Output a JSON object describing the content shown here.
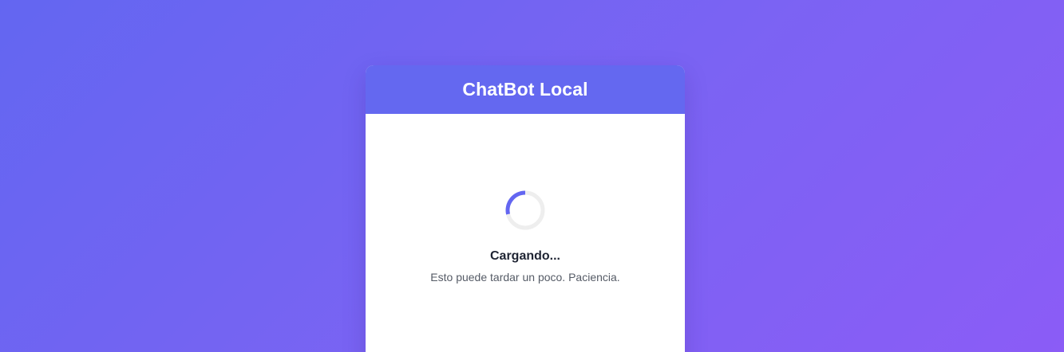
{
  "app": {
    "title": "ChatBot Local"
  },
  "loading": {
    "title": "Cargando...",
    "message": "Esto puede tardar un poco. Paciencia.",
    "spinner_icon": "loading-spinner-icon"
  },
  "colors": {
    "background_start": "#6366f1",
    "background_end": "#8b5cf6",
    "header": "#6468f0",
    "spinner_active": "#6366f1",
    "spinner_track": "#eeeeee"
  }
}
